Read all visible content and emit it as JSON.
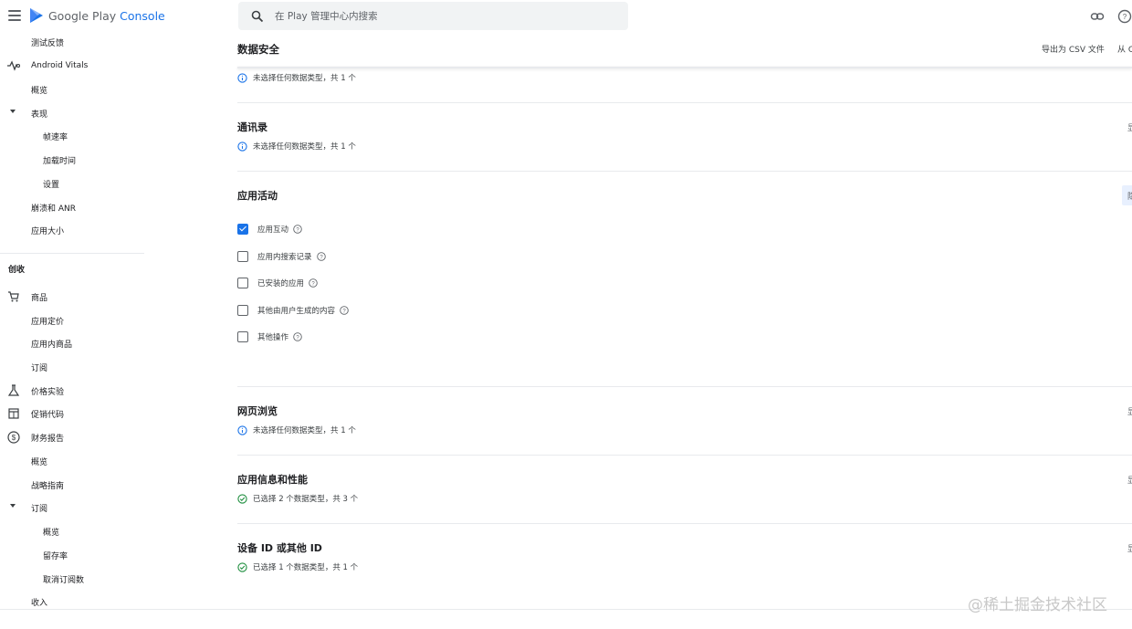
{
  "app": {
    "logo_text_1": "Google Play",
    "logo_text_2": "Console"
  },
  "search": {
    "placeholder": "在 Play 管理中心内搜索"
  },
  "sidebar": {
    "items": [
      {
        "label": "测试反馈"
      },
      {
        "label": "Android Vitals"
      },
      {
        "label": "概览"
      },
      {
        "label": "表现"
      },
      {
        "label": "帧速率"
      },
      {
        "label": "加载时间"
      },
      {
        "label": "设置"
      },
      {
        "label": "崩溃和 ANR"
      },
      {
        "label": "应用大小"
      },
      {
        "label": "商品"
      },
      {
        "label": "应用定价"
      },
      {
        "label": "应用内商品"
      },
      {
        "label": "订阅"
      },
      {
        "label": "价格实验"
      },
      {
        "label": "促销代码"
      },
      {
        "label": "财务报告"
      },
      {
        "label": "概览"
      },
      {
        "label": "战略指南"
      },
      {
        "label": "订阅"
      },
      {
        "label": "概览"
      },
      {
        "label": "留存率"
      },
      {
        "label": "取消订阅数"
      },
      {
        "label": "收入"
      }
    ],
    "section_monetize": "创收"
  },
  "main": {
    "title": "数据安全",
    "export_label": "导出为 CSV 文件",
    "from_label": "从 C",
    "top_info": "未选择任何数据类型，共 1 个",
    "sections": [
      {
        "title": "通讯录",
        "info": "未选择任何数据类型，共 1 个",
        "right": "显"
      },
      {
        "title": "应用活动",
        "right": "隐"
      },
      {
        "title": "网页浏览",
        "info": "未选择任何数据类型，共 1 个",
        "right": "显"
      },
      {
        "title": "应用信息和性能",
        "info": "已选择 2 个数据类型，共 3 个",
        "right": "显"
      },
      {
        "title": "设备 ID 或其他 ID",
        "info": "已选择 1 个数据类型，共 1 个",
        "right": "显"
      }
    ],
    "checkboxes": [
      {
        "label": "应用互动",
        "checked": true
      },
      {
        "label": "应用内搜索记录",
        "checked": false
      },
      {
        "label": "已安装的应用",
        "checked": false
      },
      {
        "label": "其他由用户生成的内容",
        "checked": false
      },
      {
        "label": "其他操作",
        "checked": false
      }
    ]
  },
  "watermark": "@稀土掘金技术社区",
  "colors": {
    "accent": "#1a73e8",
    "success": "#1e8e3e",
    "info": "#1a73e8"
  }
}
